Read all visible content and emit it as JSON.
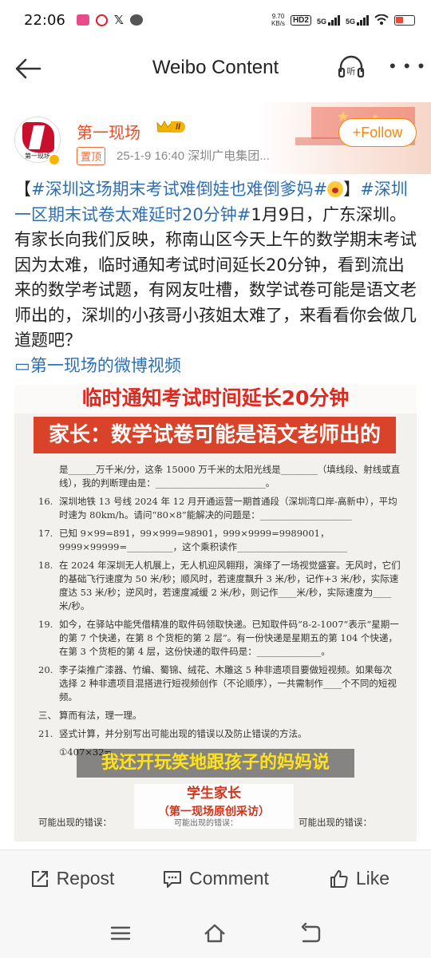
{
  "status_bar": {
    "time": "22:06",
    "net_speed_value": "9.70",
    "net_speed_unit": "KB/s",
    "hd_badge": "HD2",
    "sig1": "5G",
    "sig2": "5G"
  },
  "header": {
    "title": "Weibo Content",
    "listen_label": "听"
  },
  "post": {
    "author": "第一现场",
    "level_badge": "II",
    "pinned_label": "置顶",
    "meta": "25-1-9 16:40  深圳广电集团...",
    "follow_label": "+Follow",
    "avatar_caption": "第一现场",
    "text": {
      "bracket_open": "【",
      "hashtag1": "#深圳这场期末考试难倒娃也难倒爹妈#",
      "bracket_close": "】",
      "hashtag2": "#深圳一区期末试卷太难延时20分钟#",
      "body": "1月9日，广东深圳。有家长向我们反映，称南山区今天上午的数学期末考试因为太难，临时通知考试时间延长20分钟，看到流出来的数学考试题，有网友吐槽，数学试卷可能是语文老师出的，深圳的小孩哥小孩姐太难了，来看看你会做几道题吧？",
      "video_link_icon": "▭",
      "video_link": "第一现场的微博视频"
    }
  },
  "video": {
    "banner_top": "临时通知考试时间延长20分钟",
    "banner_main": "家长：数学试卷可能是语文老师出的",
    "exam_lines": [
      {
        "n": "",
        "t": "是______万千米/分，这条 15000 万千米的太阳光线是________（填线段、射线或直线），我的判断理由是：________________________。"
      },
      {
        "n": "16.",
        "t": "深圳地铁 13 号线 2024 年 12 月开通运营一期首通段（深圳湾口岸-高新中），平均时速为 80km/h。请问“80×8”能解决的问题是：____________________"
      },
      {
        "n": "17.",
        "t": "已知 9×99=891，99×999=98901，999×9999=9989001，9999×99999=__________，这个乘积读作________________________"
      },
      {
        "n": "18.",
        "t": "在 2024 年深圳无人机展上，无人机迎风翱翔，演绎了一场视觉盛宴。无风时，它们的基础飞行速度为 50 米/秒；顺风时，若速度飘升 3 米/秒，记作+3 米/秒，实际速度达 53 米/秒；逆风时，若速度减缓 2 米/秒，则记作____米/秒，实际速度为____米/秒。"
      },
      {
        "n": "19.",
        "t": "如今，在驿站中能凭借精准的取件码领取快递。已知取件码“8-2-1007”表示“星期一的第 7 个快递，在第 8 个货柜的第 2 层”。有一份快递是星期五的第 104 个快递，在第 3 个货柜的第 4 层，这份快递的取件码是：______________。"
      },
      {
        "n": "20.",
        "t": "李子柒推广漆器、竹编、蜀锦、绒花、木雕这 5 种非遗项目要做短视频。如果每次选择 2 种非遗项目混搭进行短视频创作（不论顺序），一共需制作____个不同的短视频。"
      },
      {
        "n": "三、",
        "t": "算而有法，理一理。"
      },
      {
        "n": "21.",
        "t": "竖式计算，并分别写出可能出现的错误以及防止错误的方法。"
      },
      {
        "n": "",
        "t": "①407×32="
      }
    ],
    "subtitle": "我还开玩笑地跟孩子的妈妈说",
    "label_line1": "学生家长",
    "label_line2": "（第一现场原创采访）",
    "error_label_left": "可能出现的错误：",
    "error_label_mid": "可能出现的错误：",
    "error_label_right": "可能出现的错误："
  },
  "actions": {
    "repost": "Repost",
    "comment": "Comment",
    "like": "Like"
  },
  "colors": {
    "accent_orange": "#ff8200",
    "hashtag_blue": "#2d6fb4",
    "author_red": "#f04a25"
  }
}
